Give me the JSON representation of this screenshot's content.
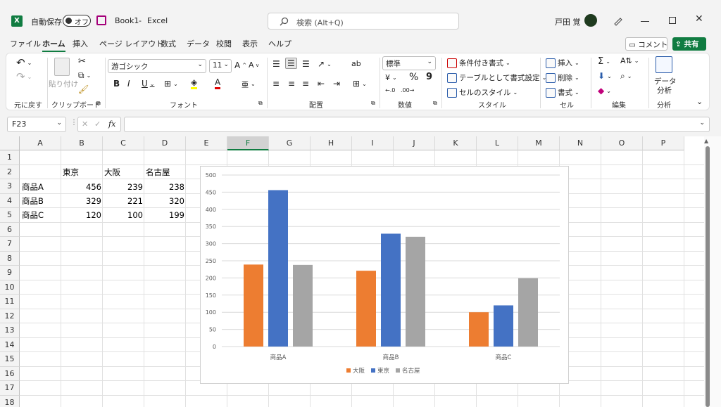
{
  "title_bar": {
    "autosave_label": "自動保存",
    "toggle_state": "オフ",
    "file_name": "Book1",
    "separator": "-",
    "app_name": "Excel",
    "search_placeholder": "検索 (Alt+Q)",
    "user_name": "戸田 覚"
  },
  "tabs": [
    {
      "label": "ファイル"
    },
    {
      "label": "ホーム"
    },
    {
      "label": "挿入"
    },
    {
      "label": "ページ レイアウト"
    },
    {
      "label": "数式"
    },
    {
      "label": "データ"
    },
    {
      "label": "校閲"
    },
    {
      "label": "表示"
    },
    {
      "label": "ヘルプ"
    }
  ],
  "top_right": {
    "comment": "コメント",
    "share": "共有"
  },
  "ribbon": {
    "undo_group": "元に戻す",
    "clipboard": {
      "paste": "貼り付け",
      "group": "クリップボード"
    },
    "font": {
      "name": "游ゴシック",
      "size": "11",
      "group": "フォント"
    },
    "alignment": {
      "group": "配置"
    },
    "number": {
      "format": "標準",
      "group": "数値",
      "percent": "%",
      "comma": "9"
    },
    "styles": {
      "conditional": "条件付き書式",
      "table": "テーブルとして書式設定",
      "cell_styles": "セルのスタイル",
      "group": "スタイル"
    },
    "cells": {
      "insert": "挿入",
      "delete": "削除",
      "format": "書式",
      "group": "セル"
    },
    "editing": {
      "group": "編集"
    },
    "analysis": {
      "data_analysis_1": "データ",
      "data_analysis_2": "分析",
      "group": "分析"
    }
  },
  "formula_bar": {
    "name_box": "F23",
    "fx": "fx",
    "value": ""
  },
  "columns": [
    "A",
    "B",
    "C",
    "D",
    "E",
    "F",
    "G",
    "H",
    "I",
    "J",
    "K",
    "L",
    "M",
    "N",
    "O",
    "P"
  ],
  "rows": [
    "1",
    "2",
    "3",
    "4",
    "5",
    "6",
    "7",
    "8",
    "9",
    "10",
    "11",
    "12",
    "13",
    "14",
    "15",
    "16",
    "17",
    "18"
  ],
  "sheet": {
    "headers": [
      "東京",
      "大阪",
      "名古屋"
    ],
    "data": [
      {
        "label": "商品A",
        "values": [
          "456",
          "239",
          "238"
        ]
      },
      {
        "label": "商品B",
        "values": [
          "329",
          "221",
          "320"
        ]
      },
      {
        "label": "商品C",
        "values": [
          "120",
          "100",
          "199"
        ]
      }
    ]
  },
  "chart_data": {
    "type": "bar",
    "categories": [
      "商品A",
      "商品B",
      "商品C"
    ],
    "series": [
      {
        "name": "大阪",
        "values": [
          239,
          221,
          100
        ],
        "color": "#ed7d31"
      },
      {
        "name": "東京",
        "values": [
          456,
          329,
          120
        ],
        "color": "#4472c4"
      },
      {
        "name": "名古屋",
        "values": [
          238,
          320,
          199
        ],
        "color": "#a5a5a5"
      }
    ],
    "yticks": [
      "0",
      "50",
      "100",
      "150",
      "200",
      "250",
      "300",
      "350",
      "400",
      "450",
      "500"
    ],
    "ylim": [
      0,
      500
    ],
    "grid": true,
    "legend": "bottom"
  }
}
